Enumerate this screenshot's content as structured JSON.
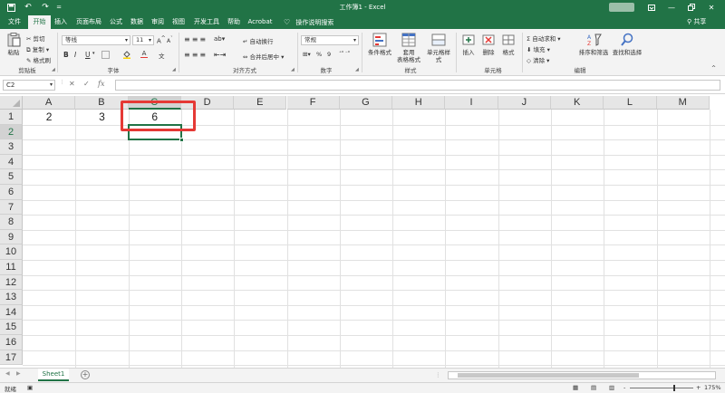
{
  "titlebar": {
    "title": "工作簿1 - Excel",
    "quick_access": [
      "save-icon",
      "undo-icon",
      "redo-icon",
      "customize-icon"
    ],
    "window_buttons": [
      "ribbon-display-icon",
      "minimize-icon",
      "restore-icon",
      "close-icon"
    ]
  },
  "tabs": [
    "文件",
    "开始",
    "插入",
    "页面布局",
    "公式",
    "数据",
    "审阅",
    "视图",
    "开发工具",
    "帮助",
    "Acrobat"
  ],
  "active_tab": "开始",
  "tell_me": "操作说明搜索",
  "share": "共享",
  "ribbon": {
    "clipboard": {
      "paste": "粘贴",
      "cut": "剪切",
      "copy": "复制",
      "format_painter": "格式刷",
      "label": "剪贴板"
    },
    "font": {
      "name": "等线",
      "size": "11",
      "bold": "B",
      "italic": "I",
      "underline": "U",
      "grow": "A",
      "shrink": "A",
      "font_color_letter": "A",
      "label": "字体"
    },
    "alignment": {
      "wrap": "自动换行",
      "merge": "合并后居中",
      "label": "对齐方式"
    },
    "number": {
      "format": "常规",
      "percent": "%",
      "comma": "9",
      "label": "数字"
    },
    "styles": {
      "conditional": "条件格式",
      "table_line1": "套用",
      "table_line2": "表格格式",
      "cell_styles": "单元格样式",
      "label": "样式"
    },
    "cells": {
      "insert": "插入",
      "delete": "删除",
      "format": "格式",
      "label": "单元格"
    },
    "editing": {
      "autosum": "自动求和",
      "fill": "填充",
      "clear": "清除",
      "sort": "排序和筛选",
      "find": "查找和选择",
      "label": "编辑"
    }
  },
  "formula_bar": {
    "name_box": "C2",
    "cancel": "✕",
    "enter": "✓",
    "fx": "fx",
    "value": ""
  },
  "columns": [
    "A",
    "B",
    "C",
    "D",
    "E",
    "F",
    "G",
    "H",
    "I",
    "J",
    "K",
    "L",
    "M"
  ],
  "rows": [
    "1",
    "2",
    "3",
    "4",
    "5",
    "6",
    "7",
    "8",
    "9",
    "10",
    "11",
    "12",
    "13",
    "14",
    "15",
    "16",
    "17"
  ],
  "selected_cell": "C2",
  "cells": {
    "A1": "2",
    "B1": "3",
    "C1": "6"
  },
  "sheets": [
    "Sheet1"
  ],
  "add_sheet": "+",
  "status": {
    "ready": "就绪",
    "zoom": "175%",
    "zoom_minus": "-",
    "zoom_plus": "+"
  }
}
